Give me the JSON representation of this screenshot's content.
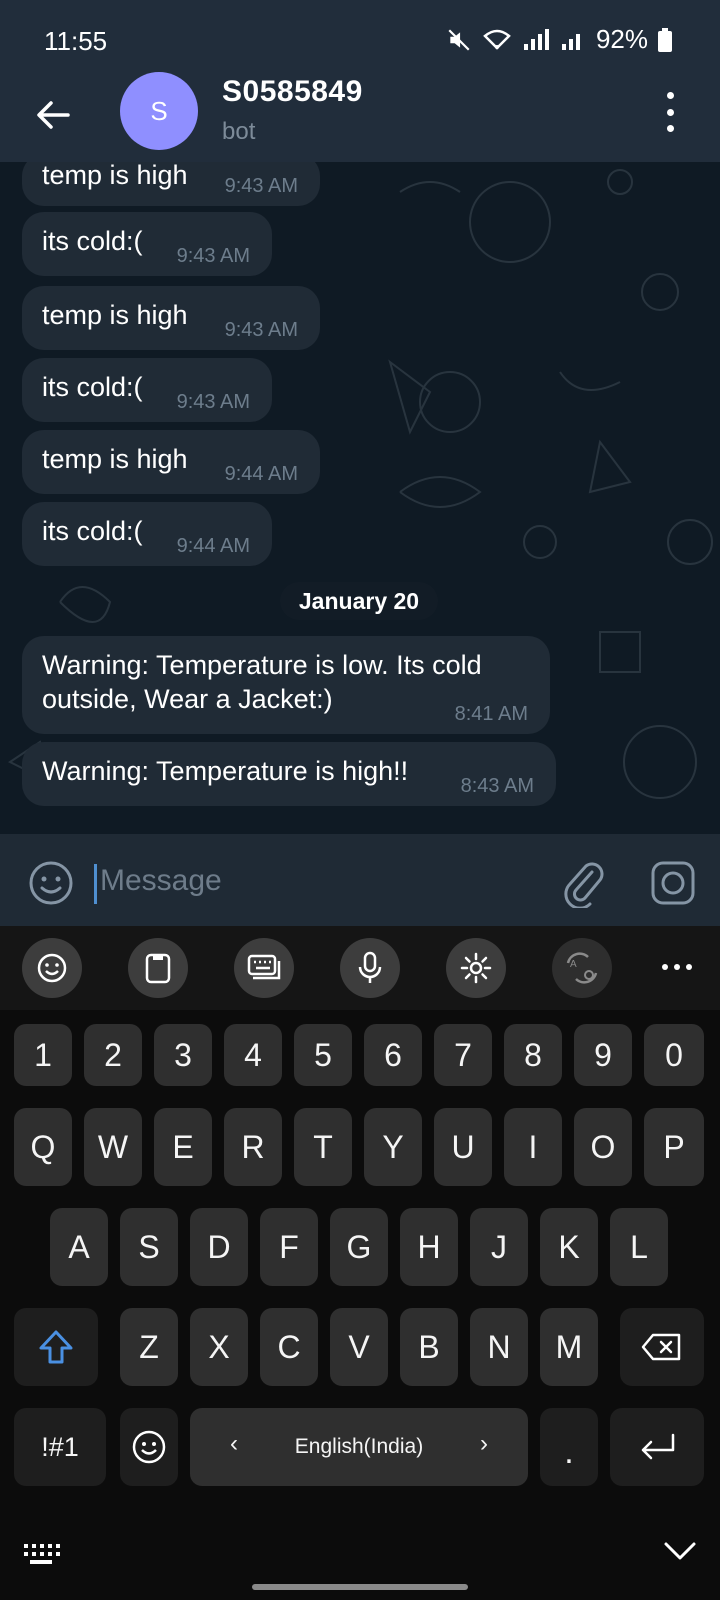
{
  "status": {
    "time": "11:55",
    "battery": "92%"
  },
  "header": {
    "avatar_letter": "S",
    "title": "S0585849",
    "subtitle": "bot"
  },
  "messages": [
    {
      "text": "temp is high",
      "time": "9:43 AM"
    },
    {
      "text": "its cold:(",
      "time": "9:43 AM"
    },
    {
      "text": "temp is high",
      "time": "9:43 AM"
    },
    {
      "text": "its cold:(",
      "time": "9:43 AM"
    },
    {
      "text": "temp is high",
      "time": "9:44 AM"
    },
    {
      "text": "its cold:(",
      "time": "9:44 AM"
    },
    {
      "text": "Warning: Temperature is low. Its cold outside, Wear a Jacket:)",
      "time": "8:41 AM"
    },
    {
      "text": "Warning: Temperature is high!!",
      "time": "8:43 AM"
    }
  ],
  "date_separator": "January 20",
  "input": {
    "placeholder": "Message"
  },
  "keyboard": {
    "numbers": [
      "1",
      "2",
      "3",
      "4",
      "5",
      "6",
      "7",
      "8",
      "9",
      "0"
    ],
    "row1": [
      "Q",
      "W",
      "E",
      "R",
      "T",
      "Y",
      "U",
      "I",
      "O",
      "P"
    ],
    "row2": [
      "A",
      "S",
      "D",
      "F",
      "G",
      "H",
      "J",
      "K",
      "L"
    ],
    "row3": [
      "Z",
      "X",
      "C",
      "V",
      "B",
      "N",
      "M"
    ],
    "symbols_key": "!#1",
    "language": "English(India)",
    "period": "."
  },
  "colors": {
    "header_bg": "#212d3b",
    "bubble_bg": "#202b36",
    "accent_blue": "#4f8fd0",
    "avatar": "#8f8fff"
  }
}
